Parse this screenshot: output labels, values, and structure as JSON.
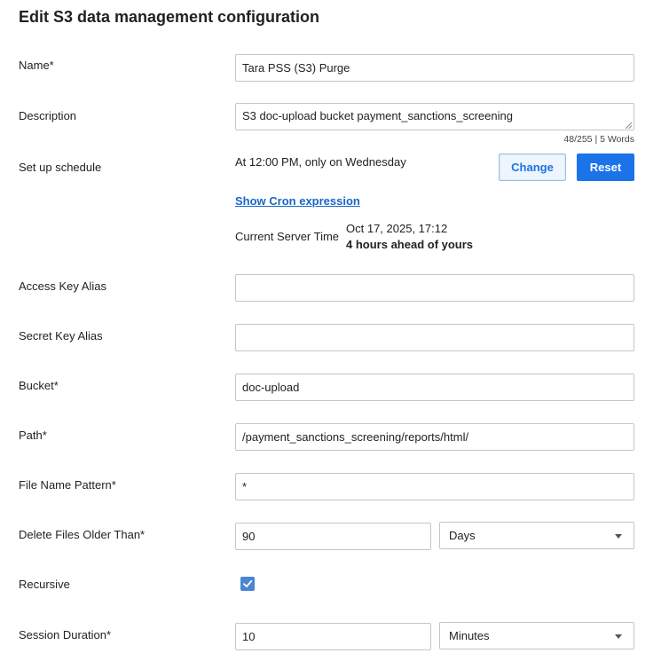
{
  "title": "Edit S3 data management configuration",
  "name": {
    "label": "Name*",
    "value": "Tara PSS (S3) Purge"
  },
  "description": {
    "label": "Description",
    "value": "S3 doc-upload bucket payment_sanctions_screening",
    "counter": "48/255 | 5 Words"
  },
  "schedule": {
    "label": "Set up schedule",
    "text": "At 12:00 PM, only on Wednesday",
    "change_label": "Change",
    "reset_label": "Reset",
    "cron_link": "Show Cron expression",
    "server_time_label": "Current Server Time",
    "server_time_value": "Oct 17, 2025, 17:12",
    "server_time_offset": "4 hours ahead of yours"
  },
  "access_key": {
    "label": "Access Key Alias",
    "value": ""
  },
  "secret_key": {
    "label": "Secret Key Alias",
    "value": ""
  },
  "bucket": {
    "label": "Bucket*",
    "value": "doc-upload"
  },
  "path": {
    "label": "Path*",
    "value": "/payment_sanctions_screening/reports/html/"
  },
  "file_pattern": {
    "label": "File Name Pattern*",
    "value": "*"
  },
  "delete_older": {
    "label": "Delete Files Older Than*",
    "value": "90",
    "unit": "Days"
  },
  "recursive": {
    "label": "Recursive",
    "checked": true
  },
  "session_duration": {
    "label": "Session Duration*",
    "value": "10",
    "unit": "Minutes"
  },
  "colors": {
    "primary": "#1a73e8",
    "link": "#1a66c9",
    "checkbox": "#4a86d4",
    "border": "#c6c6c6"
  },
  "icons": {
    "checkbox": "checkmark-icon",
    "dropdown": "chevron-down-icon",
    "resize": "resize-grip-icon"
  }
}
